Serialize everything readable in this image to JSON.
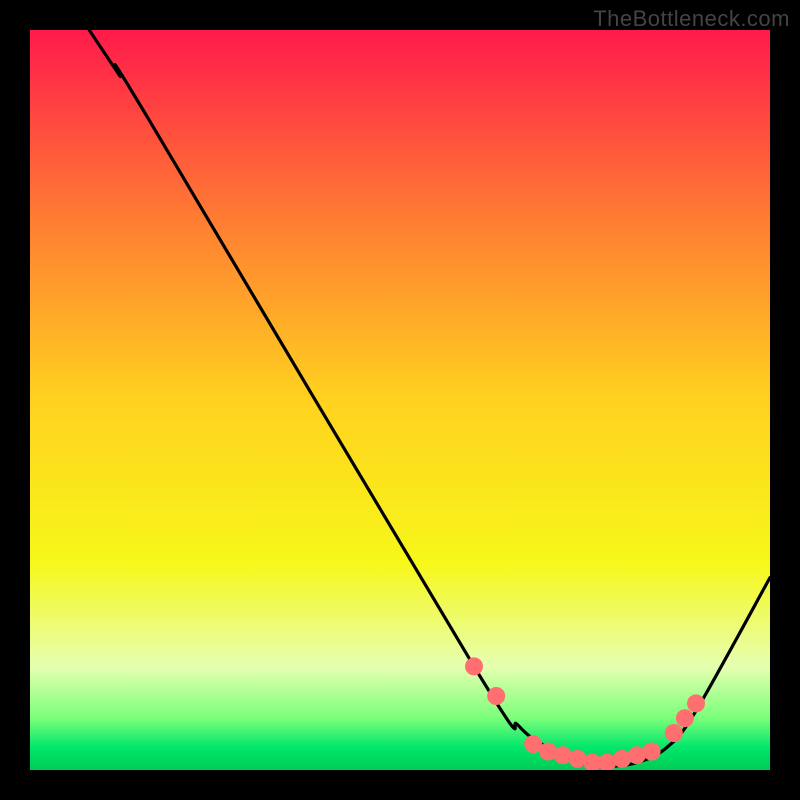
{
  "watermark": "TheBottleneck.com",
  "chart_data": {
    "type": "line",
    "title": "",
    "xlabel": "",
    "ylabel": "",
    "xlim": [
      0,
      100
    ],
    "ylim": [
      0,
      100
    ],
    "background_gradient": {
      "stops": [
        {
          "offset": 0,
          "color": "#ff1a4b"
        },
        {
          "offset": 25,
          "color": "#ff7a33"
        },
        {
          "offset": 50,
          "color": "#ffd21f"
        },
        {
          "offset": 72,
          "color": "#f7f71a"
        },
        {
          "offset": 86,
          "color": "#e6ffb0"
        },
        {
          "offset": 93,
          "color": "#7aff7a"
        },
        {
          "offset": 97,
          "color": "#00e66b"
        },
        {
          "offset": 100,
          "color": "#00cc55"
        }
      ]
    },
    "series": [
      {
        "name": "bottleneck-curve",
        "x": [
          8,
          12,
          16,
          60,
          66,
          70,
          74,
          78,
          82,
          86,
          90,
          100
        ],
        "y": [
          100,
          94,
          88,
          14,
          6,
          3,
          1,
          0.5,
          1,
          3,
          8,
          26
        ]
      }
    ],
    "markers": {
      "name": "highlight-points",
      "color": "#ff6f6f",
      "radius": 9,
      "points": [
        {
          "x": 60,
          "y": 14
        },
        {
          "x": 63,
          "y": 10
        },
        {
          "x": 68,
          "y": 3.5
        },
        {
          "x": 70,
          "y": 2.5
        },
        {
          "x": 72,
          "y": 2
        },
        {
          "x": 74,
          "y": 1.5
        },
        {
          "x": 76,
          "y": 1
        },
        {
          "x": 78,
          "y": 1
        },
        {
          "x": 80,
          "y": 1.5
        },
        {
          "x": 82,
          "y": 2
        },
        {
          "x": 84,
          "y": 2.5
        },
        {
          "x": 87,
          "y": 5
        },
        {
          "x": 88.5,
          "y": 7
        },
        {
          "x": 90,
          "y": 9
        }
      ]
    }
  }
}
